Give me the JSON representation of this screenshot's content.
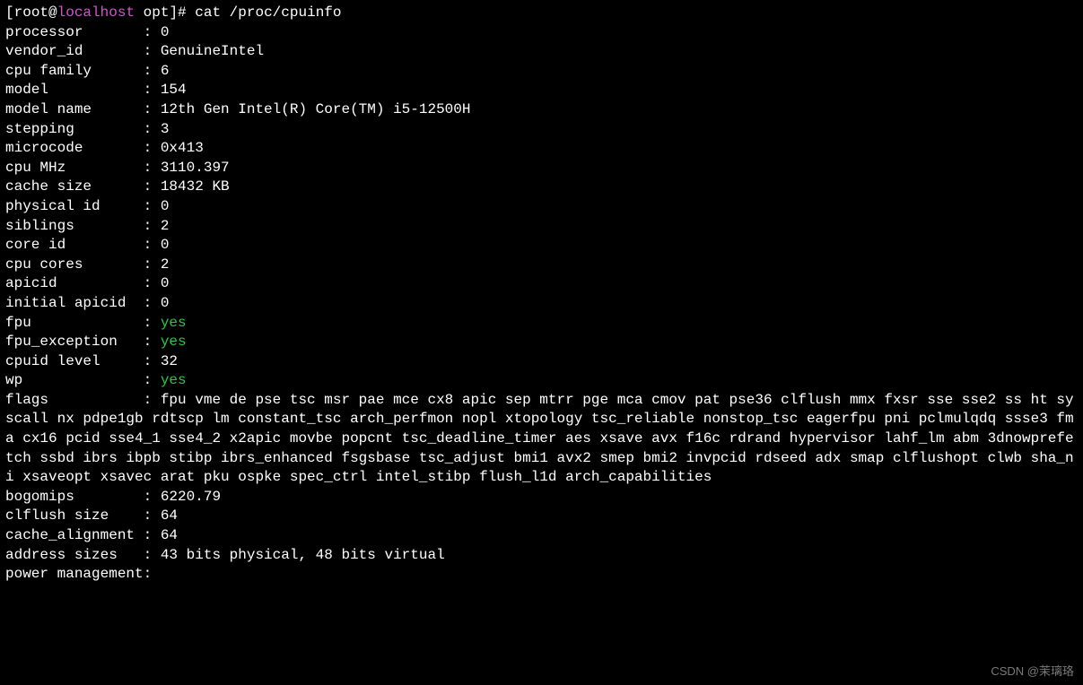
{
  "prompt": {
    "open": "[",
    "user": "root@",
    "host": "localhost",
    "path": " opt",
    "close": "]# ",
    "command": "cat /proc/cpuinfo"
  },
  "rows": [
    {
      "key": "processor",
      "value": "0"
    },
    {
      "key": "vendor_id",
      "value": "GenuineIntel"
    },
    {
      "key": "cpu family",
      "value": "6"
    },
    {
      "key": "model",
      "value": "154"
    },
    {
      "key": "model name",
      "value": "12th Gen Intel(R) Core(TM) i5-12500H"
    },
    {
      "key": "stepping",
      "value": "3"
    },
    {
      "key": "microcode",
      "value": "0x413"
    },
    {
      "key": "cpu MHz",
      "value": "3110.397"
    },
    {
      "key": "cache size",
      "value": "18432 KB"
    },
    {
      "key": "physical id",
      "value": "0"
    },
    {
      "key": "siblings",
      "value": "2"
    },
    {
      "key": "core id",
      "value": "0"
    },
    {
      "key": "cpu cores",
      "value": "2"
    },
    {
      "key": "apicid",
      "value": "0"
    },
    {
      "key": "initial apicid",
      "value": "0"
    },
    {
      "key": "fpu",
      "value": "yes",
      "green": true
    },
    {
      "key": "fpu_exception",
      "value": "yes",
      "green": true
    },
    {
      "key": "cpuid level",
      "value": "32"
    },
    {
      "key": "wp",
      "value": "yes",
      "green": true
    }
  ],
  "flags": {
    "key": "flags",
    "value": "fpu vme de pse tsc msr pae mce cx8 apic sep mtrr pge mca cmov pat pse36 clflush mmx fxsr sse sse2 ss ht syscall nx pdpe1gb rdtscp lm constant_tsc arch_perfmon nopl xtopology tsc_reliable nonstop_tsc eagerfpu pni pclmulqdq ssse3 fma cx16 pcid sse4_1 sse4_2 x2apic movbe popcnt tsc_deadline_timer aes xsave avx f16c rdrand hypervisor lahf_lm abm 3dnowprefetch ssbd ibrs ibpb stibp ibrs_enhanced fsgsbase tsc_adjust bmi1 avx2 smep bmi2 invpcid rdseed adx smap clflushopt clwb sha_ni xsaveopt xsavec arat pku ospke spec_ctrl intel_stibp flush_l1d arch_capabilities"
  },
  "tail": [
    {
      "key": "bogomips",
      "value": "6220.79"
    },
    {
      "key": "clflush size",
      "value": "64"
    },
    {
      "key": "cache_alignment",
      "value": "64"
    },
    {
      "key": "address sizes",
      "value": "43 bits physical, 48 bits virtual"
    },
    {
      "key": "power management",
      "value": ""
    }
  ],
  "watermark": "CSDN @茉璃珞"
}
